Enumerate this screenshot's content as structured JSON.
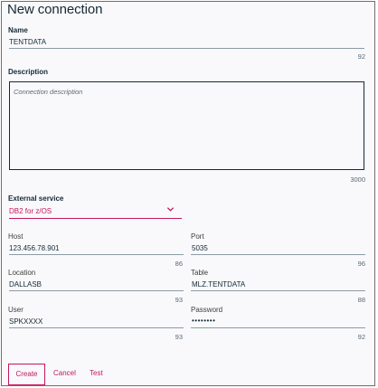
{
  "dialog": {
    "title": "New connection"
  },
  "name_field": {
    "label": "Name",
    "value": "TENTDATA",
    "counter": "92"
  },
  "description_field": {
    "label": "Description",
    "placeholder": "Connection description",
    "counter": "3000"
  },
  "external_service": {
    "label": "External service",
    "selected": "DB2 for z/OS",
    "icon": "chevron-down-icon"
  },
  "host_field": {
    "label": "Host",
    "value": "123.456.78.901",
    "counter": "86"
  },
  "port_field": {
    "label": "Port",
    "value": "5035",
    "counter": "96"
  },
  "location_field": {
    "label": "Location",
    "value": "DALLASB",
    "counter": "93"
  },
  "table_field": {
    "label": "Table",
    "value": "MLZ.TENTDATA",
    "counter": "88"
  },
  "user_field": {
    "label": "User",
    "value": "SPKXXXX",
    "counter": "93"
  },
  "password_field": {
    "label": "Password",
    "value": "••••••••",
    "counter": "92"
  },
  "actions": {
    "create_label": "Create",
    "cancel_label": "Cancel",
    "test_label": "Test"
  },
  "colors": {
    "accent": "#c2185b",
    "text": "#152935",
    "underline": "#8c9ba5",
    "background": "#f9f9fb"
  }
}
